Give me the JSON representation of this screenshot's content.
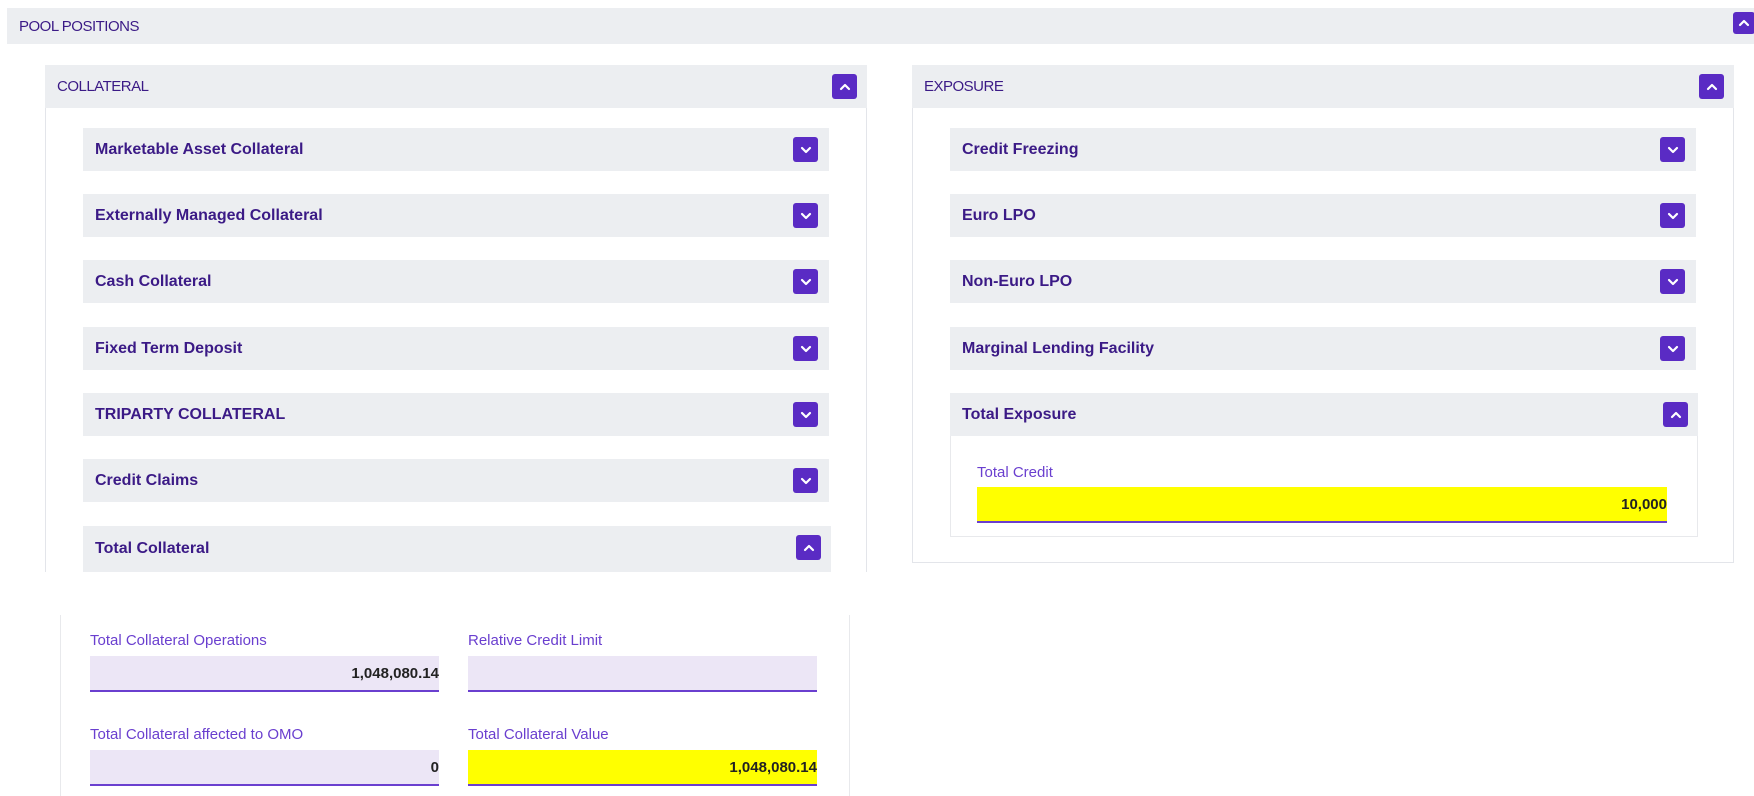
{
  "pool": {
    "title": "POOL POSITIONS"
  },
  "collateral": {
    "title": "COLLATERAL",
    "items": [
      {
        "label": "Marketable Asset Collateral"
      },
      {
        "label": "Externally Managed Collateral"
      },
      {
        "label": "Cash Collateral"
      },
      {
        "label": "Fixed Term Deposit"
      },
      {
        "label": "TRIPARTY COLLATERAL"
      },
      {
        "label": "Credit Claims"
      },
      {
        "label": "Total Collateral"
      }
    ],
    "fields": {
      "total_collateral_operations": {
        "label": "Total Collateral Operations",
        "value": "1,048,080.14"
      },
      "relative_credit_limit": {
        "label": "Relative Credit Limit",
        "value": ""
      },
      "total_collateral_affected_omo": {
        "label": "Total Collateral affected to OMO",
        "value": "0"
      },
      "total_collateral_value": {
        "label": "Total Collateral Value",
        "value": "1,048,080.14"
      }
    }
  },
  "exposure": {
    "title": "EXPOSURE",
    "items": [
      {
        "label": "Credit Freezing"
      },
      {
        "label": "Euro LPO"
      },
      {
        "label": "Non-Euro LPO"
      },
      {
        "label": "Marginal Lending Facility"
      },
      {
        "label": "Total Exposure"
      }
    ],
    "total_credit": {
      "label": "Total Credit",
      "value": "10,000"
    }
  },
  "colors": {
    "accent": "#5a2bc4",
    "bar_background": "#eceef1",
    "highlight": "#ffff00",
    "field_background": "#ece6f6",
    "label_text": "#3b1a86"
  },
  "icons": {
    "expanded": "chevron-up-icon",
    "collapsed": "chevron-down-icon"
  }
}
